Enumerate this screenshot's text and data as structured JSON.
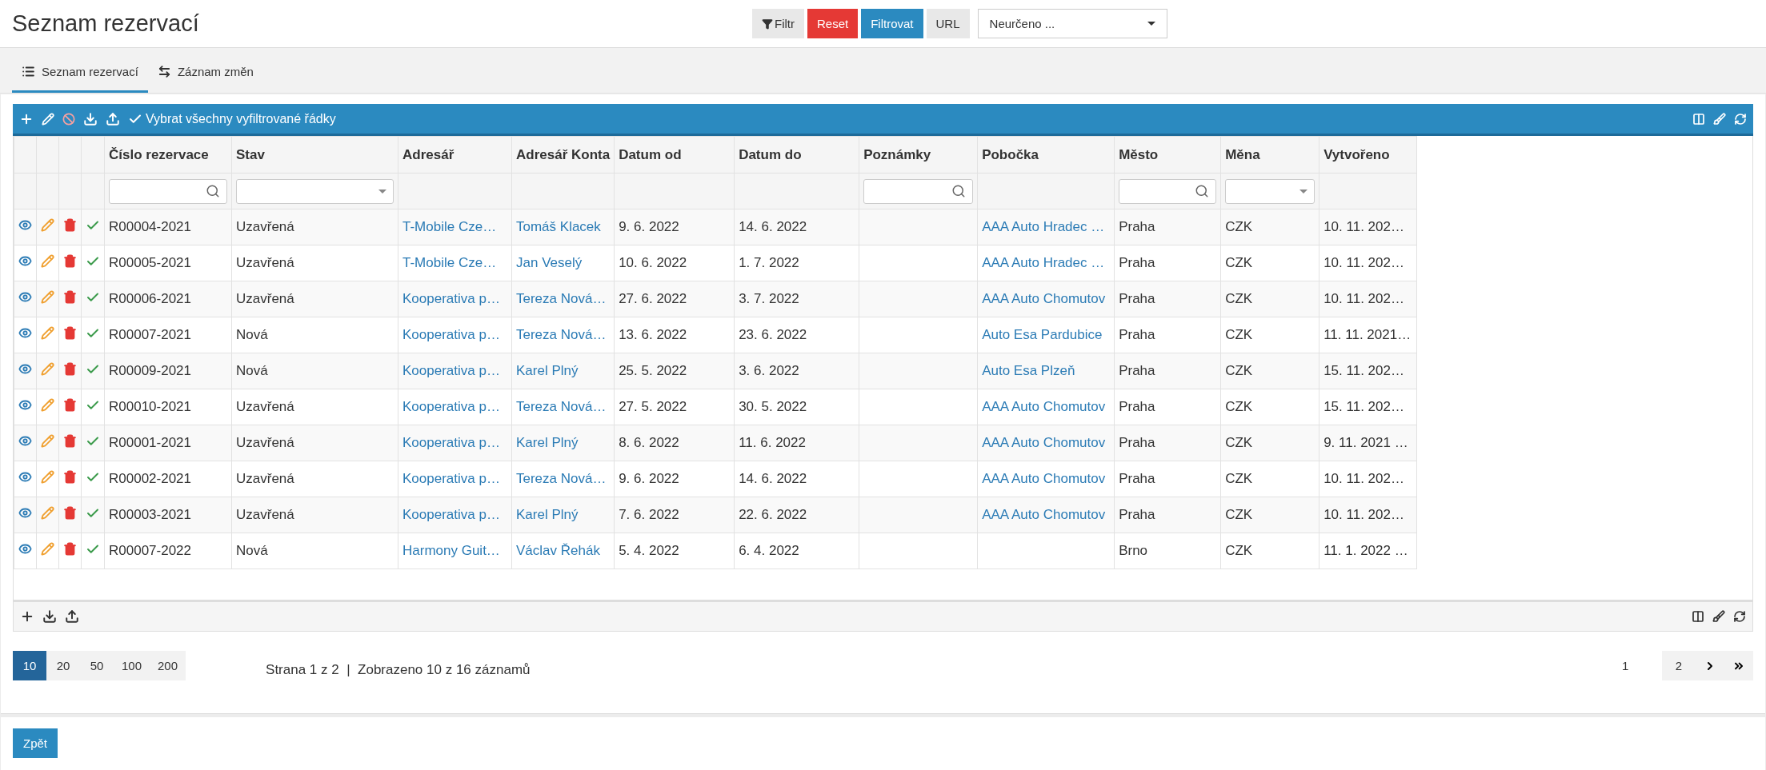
{
  "header": {
    "title": "Seznam rezervací",
    "buttons": [
      {
        "kind": "filter",
        "label": "Filtr"
      },
      {
        "kind": "danger",
        "label": "Reset"
      },
      {
        "kind": "primary",
        "label": "Filtrovat"
      },
      {
        "kind": "plain",
        "label": "URL"
      }
    ],
    "select": {
      "value": "Neurčeno ..."
    }
  },
  "tabs": [
    {
      "label": "Seznam rezervací",
      "selected": true
    },
    {
      "label": "Záznam změn",
      "selected": false
    }
  ],
  "toolbar": {
    "select_all": "Vybrat všechny vyfiltrované řádky"
  },
  "table": {
    "columns": [
      {
        "label": "Číslo rezervace",
        "kind": "text"
      },
      {
        "label": "Stav",
        "kind": "text"
      },
      {
        "label": "Adresář",
        "kind": "link"
      },
      {
        "label": "Adresář Konta",
        "kind": "link"
      },
      {
        "label": "Datum od",
        "kind": "text"
      },
      {
        "label": "Datum do",
        "kind": "text"
      },
      {
        "label": "Poznámky",
        "kind": "text"
      },
      {
        "label": "Pobočka",
        "kind": "link"
      },
      {
        "label": "Město",
        "kind": "text"
      },
      {
        "label": "Měna",
        "kind": "text"
      },
      {
        "label": "Vytvořeno",
        "kind": "text"
      }
    ],
    "filters": [
      {
        "kind": "search"
      },
      {
        "kind": "select"
      },
      {
        "kind": "none"
      },
      {
        "kind": "none"
      },
      {
        "kind": "none"
      },
      {
        "kind": "none"
      },
      {
        "kind": "search"
      },
      {
        "kind": "none"
      },
      {
        "kind": "search"
      },
      {
        "kind": "select"
      },
      {
        "kind": "none"
      }
    ],
    "rows": [
      [
        "R00004-2021",
        "Uzavřená",
        "T-Mobile Cze…",
        "Tomáš Klacek",
        "9. 6. 2022",
        "14. 6. 2022",
        null,
        "AAA Auto Hradec …",
        "Praha",
        "CZK",
        "10. 11. 202…"
      ],
      [
        "R00005-2021",
        "Uzavřená",
        "T-Mobile Cze…",
        "Jan Veselý",
        "10. 6. 2022",
        "1. 7. 2022",
        null,
        "AAA Auto Hradec …",
        "Praha",
        "CZK",
        "10. 11. 202…"
      ],
      [
        "R00006-2021",
        "Uzavřená",
        "Kooperativa p…",
        "Tereza Nová…",
        "27. 6. 2022",
        "3. 7. 2022",
        null,
        "AAA Auto Chomutov",
        "Praha",
        "CZK",
        "10. 11. 202…"
      ],
      [
        "R00007-2021",
        "Nová",
        "Kooperativa p…",
        "Tereza Nová…",
        "13. 6. 2022",
        "23. 6. 2022",
        null,
        "Auto Esa Pardubice",
        "Praha",
        "CZK",
        "11. 11. 2021…"
      ],
      [
        "R00009-2021",
        "Nová",
        "Kooperativa p…",
        "Karel Plný",
        "25. 5. 2022",
        "3. 6. 2022",
        null,
        "Auto Esa Plzeň",
        "Praha",
        "CZK",
        "15. 11. 202…"
      ],
      [
        "R00010-2021",
        "Uzavřená",
        "Kooperativa p…",
        "Tereza Nová…",
        "27. 5. 2022",
        "30. 5. 2022",
        null,
        "AAA Auto Chomutov",
        "Praha",
        "CZK",
        "15. 11. 202…"
      ],
      [
        "R00001-2021",
        "Uzavřená",
        "Kooperativa p…",
        "Karel Plný",
        "8. 6. 2022",
        "11. 6. 2022",
        null,
        "AAA Auto Chomutov",
        "Praha",
        "CZK",
        "9. 11. 2021 …"
      ],
      [
        "R00002-2021",
        "Uzavřená",
        "Kooperativa p…",
        "Tereza Nová…",
        "9. 6. 2022",
        "14. 6. 2022",
        null,
        "AAA Auto Chomutov",
        "Praha",
        "CZK",
        "10. 11. 202…"
      ],
      [
        "R00003-2021",
        "Uzavřená",
        "Kooperativa p…",
        "Karel Plný",
        "7. 6. 2022",
        "22. 6. 2022",
        null,
        "AAA Auto Chomutov",
        "Praha",
        "CZK",
        "10. 11. 202…"
      ],
      [
        "R00007-2022",
        "Nová",
        "Harmony Guit…",
        "Václav Řehák",
        "5. 4. 2022",
        "6. 4. 2022",
        null,
        null,
        "Brno",
        "CZK",
        "11. 1. 2022 …"
      ]
    ]
  },
  "page_sizes": [
    {
      "label": "10",
      "selected": true
    },
    {
      "label": "20",
      "selected": false
    },
    {
      "label": "50",
      "selected": false
    },
    {
      "label": "100",
      "selected": false
    },
    {
      "label": "200",
      "selected": false
    }
  ],
  "status": "Strana 1 z 2  |  Zobrazeno 10 z 16 záznamů",
  "pages": [
    {
      "label": "1",
      "selected": true
    },
    {
      "label": "2",
      "selected": false
    }
  ],
  "back_button": "Zpět"
}
